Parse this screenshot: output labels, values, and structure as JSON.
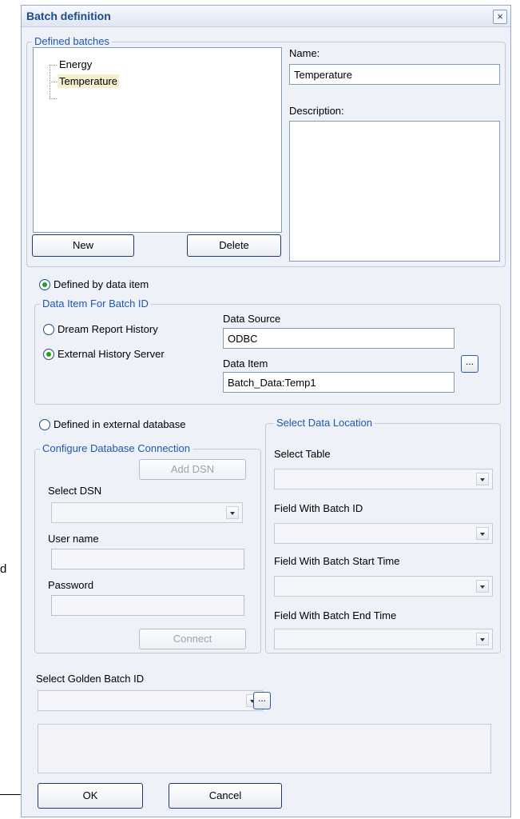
{
  "external_text": "d",
  "dialog": {
    "title": "Batch definition",
    "close_glyph": "×"
  },
  "defined_batches": {
    "legend": "Defined batches",
    "items": [
      {
        "label": "Energy",
        "selected": false
      },
      {
        "label": "Temperature",
        "selected": true
      }
    ],
    "new_label": "New",
    "delete_label": "Delete"
  },
  "name": {
    "label": "Name:",
    "value": "Temperature"
  },
  "description": {
    "label": "Description:",
    "value": ""
  },
  "defined_by_data_item": {
    "label": "Defined by data item",
    "checked": true
  },
  "data_item_group": {
    "legend": "Data Item For Batch ID",
    "dream_report_label": "Dream Report History",
    "external_label": "External History Server",
    "selected": "External History Server",
    "data_source_label": "Data Source",
    "data_source_value": "ODBC",
    "data_item_label": "Data Item",
    "data_item_value": "Batch_Data:Temp1",
    "browse_label": "..."
  },
  "defined_in_external_db": {
    "label": "Defined in external database",
    "checked": false
  },
  "db_connection": {
    "legend": "Configure Database Connection",
    "add_dsn_label": "Add DSN",
    "select_dsn_label": "Select DSN",
    "select_dsn_value": "",
    "user_name_label": "User name",
    "user_name_value": "",
    "password_label": "Password",
    "password_value": "",
    "connect_label": "Connect"
  },
  "data_location": {
    "legend": "Select Data Location",
    "table_label": "Select Table",
    "batch_id_field_label": "Field With Batch ID",
    "start_time_field_label": "Field With Batch Start Time",
    "end_time_field_label": "Field With Batch End Time"
  },
  "golden_batch": {
    "label": "Select Golden Batch ID",
    "value": "",
    "browse_label": "..."
  },
  "footer": {
    "ok_label": "OK",
    "cancel_label": "Cancel"
  },
  "icons": [
    "close-icon",
    "chevron-down-icon",
    "radio-icon"
  ],
  "colors": {
    "title": "#1d4a8c",
    "legend": "#1f56b0",
    "radio_dot": "#21a121",
    "selected_item": "#f5efcf"
  }
}
